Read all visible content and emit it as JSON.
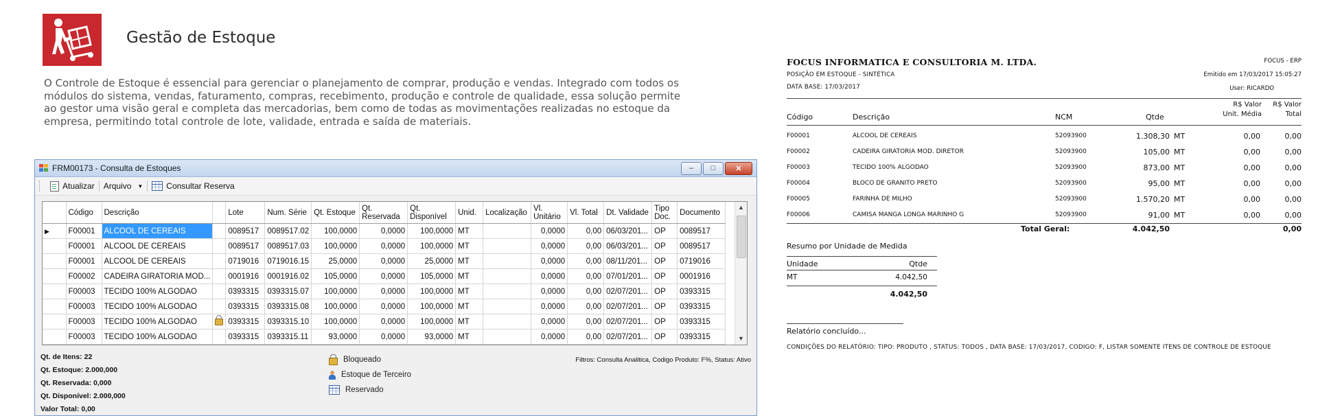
{
  "intro": {
    "title": "Gestão de Estoque",
    "description": "O Controle de Estoque é essencial para gerenciar o planejamento de comprar, produção e vendas. Integrado com todos os módulos do sistema, vendas, faturamento, compras, recebimento, produção e controle de qualidade, essa solução permite ao gestor uma visão geral e completa das mercadorias, bem como de todas as movimentações realizadas no estoque da empresa, permitindo total controle de lote, validade, entrada e saída de materiais.",
    "logo_icon": "hand-truck-icon",
    "brand_color": "#c8282e"
  },
  "window": {
    "title": "FRM00173 - Consulta de Estoques",
    "toolbar": {
      "refresh_label": "Atualizar",
      "file_label": "Arquivo",
      "reserve_label": "Consultar Reserva"
    },
    "grid": {
      "columns": [
        "Código",
        "Descrição",
        "",
        "Lote",
        "Num. Série",
        "Qt. Estoque",
        "Qt. Reservada",
        "Qt. Disponível",
        "Unid.",
        "Localização",
        "Vl. Unitário",
        "Vl. Total",
        "Dt. Validade",
        "Tipo Doc.",
        "Documento"
      ],
      "rows": [
        {
          "codigo": "F00001",
          "descricao": "ALCOOL DE CEREAIS",
          "lock": false,
          "lote": "0089517",
          "serie": "0089517.02",
          "qt_estoque": "100,0000",
          "qt_reservada": "0,0000",
          "qt_disponivel": "100,0000",
          "unid": "MT",
          "localizacao": "",
          "vl_unitario": "0,0000",
          "vl_total": "0,00",
          "validade": "06/03/201...",
          "tipo_doc": "OP",
          "documento": "0089517"
        },
        {
          "codigo": "F00001",
          "descricao": "ALCOOL DE CEREAIS",
          "lock": false,
          "lote": "0089517",
          "serie": "0089517.03",
          "qt_estoque": "100,0000",
          "qt_reservada": "0,0000",
          "qt_disponivel": "100,0000",
          "unid": "MT",
          "localizacao": "",
          "vl_unitario": "0,0000",
          "vl_total": "0,00",
          "validade": "06/03/201...",
          "tipo_doc": "OP",
          "documento": "0089517"
        },
        {
          "codigo": "F00001",
          "descricao": "ALCOOL DE CEREAIS",
          "lock": false,
          "lote": "0719016",
          "serie": "0719016.15",
          "qt_estoque": "25,0000",
          "qt_reservada": "0,0000",
          "qt_disponivel": "25,0000",
          "unid": "MT",
          "localizacao": "",
          "vl_unitario": "0,0000",
          "vl_total": "0,00",
          "validade": "08/11/201...",
          "tipo_doc": "OP",
          "documento": "0719016"
        },
        {
          "codigo": "F00002",
          "descricao": "CADEIRA GIRATORIA MOD...",
          "lock": false,
          "lote": "0001916",
          "serie": "0001916.02",
          "qt_estoque": "105,0000",
          "qt_reservada": "0,0000",
          "qt_disponivel": "105,0000",
          "unid": "MT",
          "localizacao": "",
          "vl_unitario": "0,0000",
          "vl_total": "0,00",
          "validade": "07/01/201...",
          "tipo_doc": "OP",
          "documento": "0001916"
        },
        {
          "codigo": "F00003",
          "descricao": "TECIDO 100% ALGODAO",
          "lock": false,
          "lote": "0393315",
          "serie": "0393315.07",
          "qt_estoque": "100,0000",
          "qt_reservada": "0,0000",
          "qt_disponivel": "100,0000",
          "unid": "MT",
          "localizacao": "",
          "vl_unitario": "0,0000",
          "vl_total": "0,00",
          "validade": "02/07/201...",
          "tipo_doc": "OP",
          "documento": "0393315"
        },
        {
          "codigo": "F00003",
          "descricao": "TECIDO 100% ALGODAO",
          "lock": false,
          "lote": "0393315",
          "serie": "0393315.08",
          "qt_estoque": "100,0000",
          "qt_reservada": "0,0000",
          "qt_disponivel": "100,0000",
          "unid": "MT",
          "localizacao": "",
          "vl_unitario": "0,0000",
          "vl_total": "0,00",
          "validade": "02/07/201...",
          "tipo_doc": "OP",
          "documento": "0393315"
        },
        {
          "codigo": "F00003",
          "descricao": "TECIDO 100% ALGODAO",
          "lock": true,
          "lote": "0393315",
          "serie": "0393315.10",
          "qt_estoque": "100,0000",
          "qt_reservada": "0,0000",
          "qt_disponivel": "100,0000",
          "unid": "MT",
          "localizacao": "",
          "vl_unitario": "0,0000",
          "vl_total": "0,00",
          "validade": "02/07/201...",
          "tipo_doc": "OP",
          "documento": "0393315"
        },
        {
          "codigo": "F00003",
          "descricao": "TECIDO 100% ALGODAO",
          "lock": false,
          "lote": "0393315",
          "serie": "0393315.11",
          "qt_estoque": "93,0000",
          "qt_reservada": "0,0000",
          "qt_disponivel": "93,0000",
          "unid": "MT",
          "localizacao": "",
          "vl_unitario": "0,0000",
          "vl_total": "0,00",
          "validade": "02/07/201...",
          "tipo_doc": "OP",
          "documento": "0393315"
        }
      ]
    },
    "stats": {
      "itens_label": "Qt. de Itens:",
      "itens": "22",
      "estoque_label": "Qt. Estoque:",
      "estoque": "2.000,000",
      "reservada_label": "Qt. Reservada:",
      "reservada": "0,000",
      "disponivel_label": "Qt. Disponível:",
      "disponivel": "2.000,000",
      "valor_label": "Valor Total:",
      "valor": "0,00"
    },
    "legend": {
      "blocked": "Bloqueado",
      "third_party": "Estoque de Terceiro",
      "reserved": "Reservado"
    },
    "filters": "Filtros: Consulta Analitica, Codigo Produto: F%, Status: Ativo"
  },
  "report": {
    "company": "FOCUS INFORMATICA E CONSULTORIA M. LTDA.",
    "report_name": "POSIÇÃO EM ESTOQUE - SINTÉTICA",
    "base_date": "DATA BASE: 17/03/2017",
    "system": "FOCUS - ERP",
    "issued": "Emitido em 17/03/2017  15:05:27",
    "user": "User: RICARDO",
    "headers": {
      "codigo": "Código",
      "descricao": "Descrição",
      "ncm": "NCM",
      "qtde": "Qtde",
      "vl_unit_1": "R$ Valor",
      "vl_unit_2": "Unit. Média",
      "vl_total_1": "R$ Valor",
      "vl_total_2": "Total"
    },
    "rows": [
      {
        "codigo": "F00001",
        "descricao": "ALCOOL DE CEREAIS",
        "ncm": "52093900",
        "qtde": "1.308,30",
        "unid": "MT",
        "unit": "0,00",
        "total": "0,00"
      },
      {
        "codigo": "F00002",
        "descricao": "CADEIRA GIRATORIA MOD. DIRETOR",
        "ncm": "52093900",
        "qtde": "105,00",
        "unid": "MT",
        "unit": "0,00",
        "total": "0,00"
      },
      {
        "codigo": "F00003",
        "descricao": "TECIDO 100% ALGODAO",
        "ncm": "52093900",
        "qtde": "873,00",
        "unid": "MT",
        "unit": "0,00",
        "total": "0,00"
      },
      {
        "codigo": "F00004",
        "descricao": "BLOCO DE GRANITO PRETO",
        "ncm": "52093900",
        "qtde": "95,00",
        "unid": "MT",
        "unit": "0,00",
        "total": "0,00"
      },
      {
        "codigo": "F00005",
        "descricao": "FARINHA DE MILHO",
        "ncm": "52093900",
        "qtde": "1.570,20",
        "unid": "MT",
        "unit": "0,00",
        "total": "0,00"
      },
      {
        "codigo": "F00006",
        "descricao": "CAMISA MANGA LONGA MARINHO G",
        "ncm": "52093900",
        "qtde": "91,00",
        "unid": "MT",
        "unit": "0,00",
        "total": "0,00"
      }
    ],
    "total_label": "Total Geral:",
    "total_qtde": "4.042,50",
    "total_valor": "0,00",
    "summary_title": "Resumo por Unidade de Medida",
    "summary_unit_header": "Unidade",
    "summary_qtde_header": "Qtde",
    "summary_rows": [
      {
        "unidade": "MT",
        "qtde": "4.042,50"
      }
    ],
    "summary_total": "4.042,50",
    "concluded": "Relatório concluído...",
    "conditions": "CONDIÇÕES DO RELATÓRIO: TIPO: PRODUTO , STATUS: TODOS , DATA BASE: 17/03/2017, CODIGO: F, LISTAR SOMENTE ITENS DE CONTROLE DE ESTOQUE"
  }
}
